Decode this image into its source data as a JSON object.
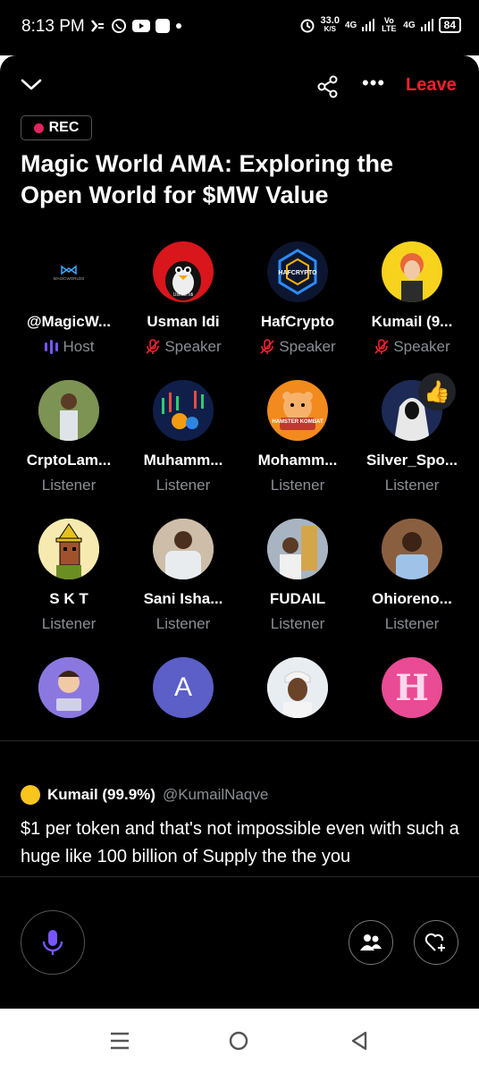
{
  "status_bar": {
    "time": "8:13 PM",
    "speed": "33.0",
    "speed_unit": "K/S",
    "net1": "4G",
    "net2": "Vo LTE",
    "net3": "4G",
    "battery": "84"
  },
  "header": {
    "leave_label": "Leave",
    "rec_label": "REC"
  },
  "title": "Magic World AMA: Exploring the Open World for $MW Value",
  "participants": [
    {
      "name": "@MagicW...",
      "role": "Host"
    },
    {
      "name": "Usman Idi",
      "role": "Speaker"
    },
    {
      "name": "HafCrypto",
      "role": "Speaker"
    },
    {
      "name": "Kumail (9...",
      "role": "Speaker"
    },
    {
      "name": "CrptoLam...",
      "role": "Listener"
    },
    {
      "name": "Muhamm...",
      "role": "Listener"
    },
    {
      "name": "Mohamm...",
      "role": "Listener"
    },
    {
      "name": "Silver_Spo...",
      "role": "Listener"
    },
    {
      "name": "S K T",
      "role": "Listener"
    },
    {
      "name": "Sani Isha...",
      "role": "Listener"
    },
    {
      "name": "FUDAIL",
      "role": "Listener"
    },
    {
      "name": "Ohioreno...",
      "role": "Listener"
    }
  ],
  "avatar_text": {
    "magicworlds": "MAGICWORLDS",
    "usman": "Usman Idi",
    "hafcrypto": "HAFCRYPTO",
    "hamster": "HAMSTER KOMBAT",
    "letter_a": "A",
    "letter_h": "H"
  },
  "reaction_emoji": "👍",
  "post": {
    "author": "Kumail (99.9%)",
    "handle": "@KumailNaqve",
    "text": "$1 per token and that's not impossible even with such a huge like 100 billion of Supply the the you"
  },
  "colors": {
    "accent_red": "#f4212e",
    "accent_purple": "#7856ff",
    "rec_dot": "#e0245e"
  }
}
